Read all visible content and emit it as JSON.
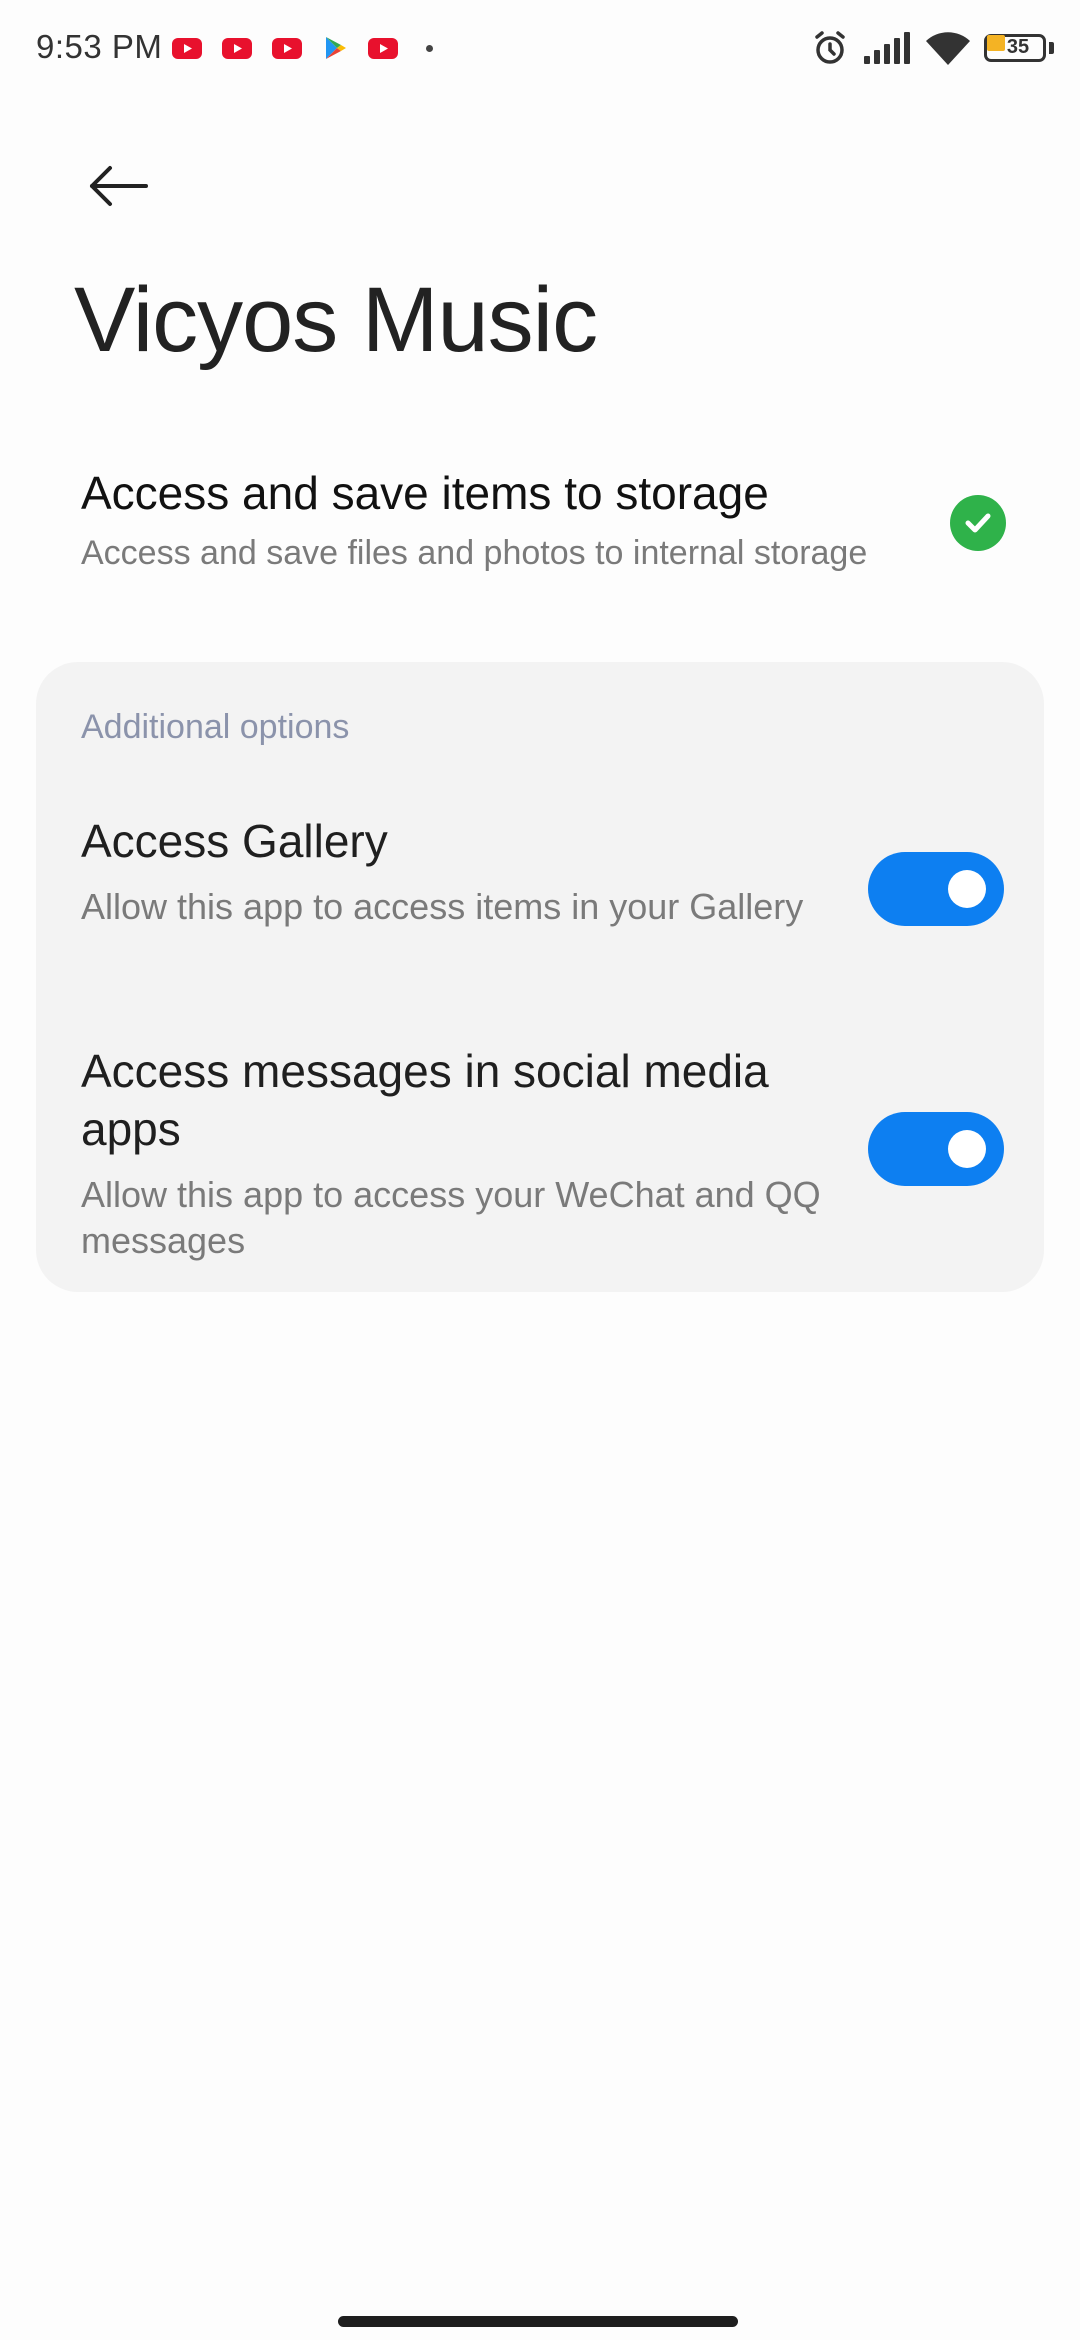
{
  "status_bar": {
    "time": "9:53 PM",
    "notification_icons": [
      "youtube-icon",
      "youtube-icon",
      "youtube-icon",
      "play-store-icon",
      "youtube-icon",
      "dot-icon"
    ],
    "status_icons": [
      "alarm-icon",
      "signal-icon",
      "wifi-icon",
      "battery-icon"
    ],
    "battery_level": "35",
    "battery_fill_color": "#f4b324"
  },
  "header": {
    "back_icon": "arrow-left-icon",
    "title": "Vicyos Music"
  },
  "storage_permission": {
    "title": "Access and save items to storage",
    "description": "Access and save files and photos to internal storage",
    "status_icon": "check-circle-icon",
    "status_color": "#2fb24a"
  },
  "additional_options": {
    "header": "Additional options",
    "items": [
      {
        "title": "Access Gallery",
        "description": "Allow this app to access items in your Gallery",
        "enabled": true
      },
      {
        "title": "Access messages in social media apps",
        "description": "Allow this app to access your WeChat and QQ messages",
        "enabled": true
      }
    ]
  },
  "colors": {
    "accent": "#0d7ff1",
    "card_background": "#f3f3f3",
    "section_header": "#8b93ab"
  }
}
